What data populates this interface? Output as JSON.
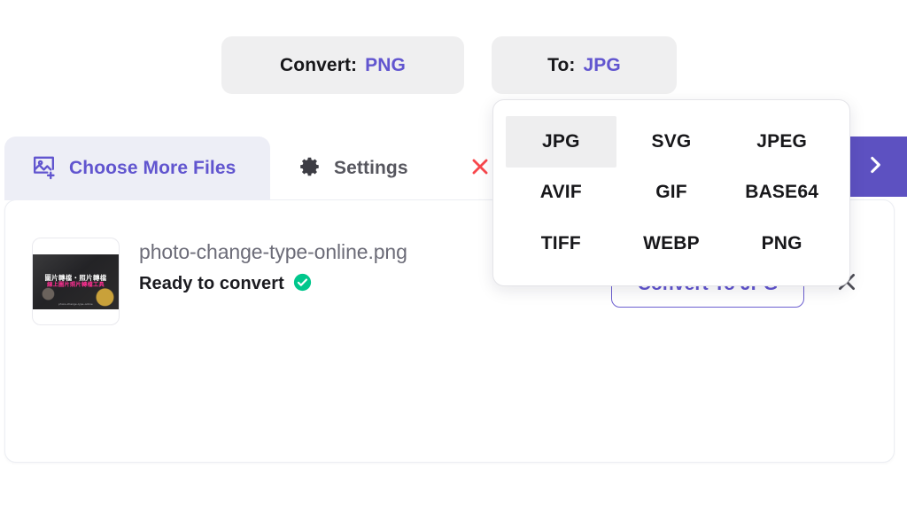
{
  "toolbar": {
    "from_pill": {
      "label": "Convert:",
      "value": "PNG"
    },
    "to_pill": {
      "label": "To:",
      "value": "JPG"
    }
  },
  "tabs": {
    "choose_files": "Choose More Files",
    "settings": "Settings",
    "close_label": "✕",
    "next_label": "›"
  },
  "dropdown": {
    "selected": "JPG",
    "options": [
      "JPG",
      "SVG",
      "JPEG",
      "AVIF",
      "GIF",
      "BASE64",
      "TIFF",
      "WEBP",
      "PNG"
    ]
  },
  "file": {
    "name": "photo-change-type-online.png",
    "status": "Ready to convert",
    "convert_button": "Convert To JPG",
    "remove_label": "✕",
    "thumbnail": {
      "line1": "圖片轉檔・照片轉檔",
      "line2": "線上圖片照片轉檔工具",
      "line3": "photo-change-type-online"
    }
  },
  "colors": {
    "accent": "#6155cf",
    "next_button": "#5d51c1",
    "close_red": "#f8474c",
    "status_green": "#00c78c",
    "pill_bg": "#efeff0",
    "tab_active_bg": "#edeef6"
  }
}
